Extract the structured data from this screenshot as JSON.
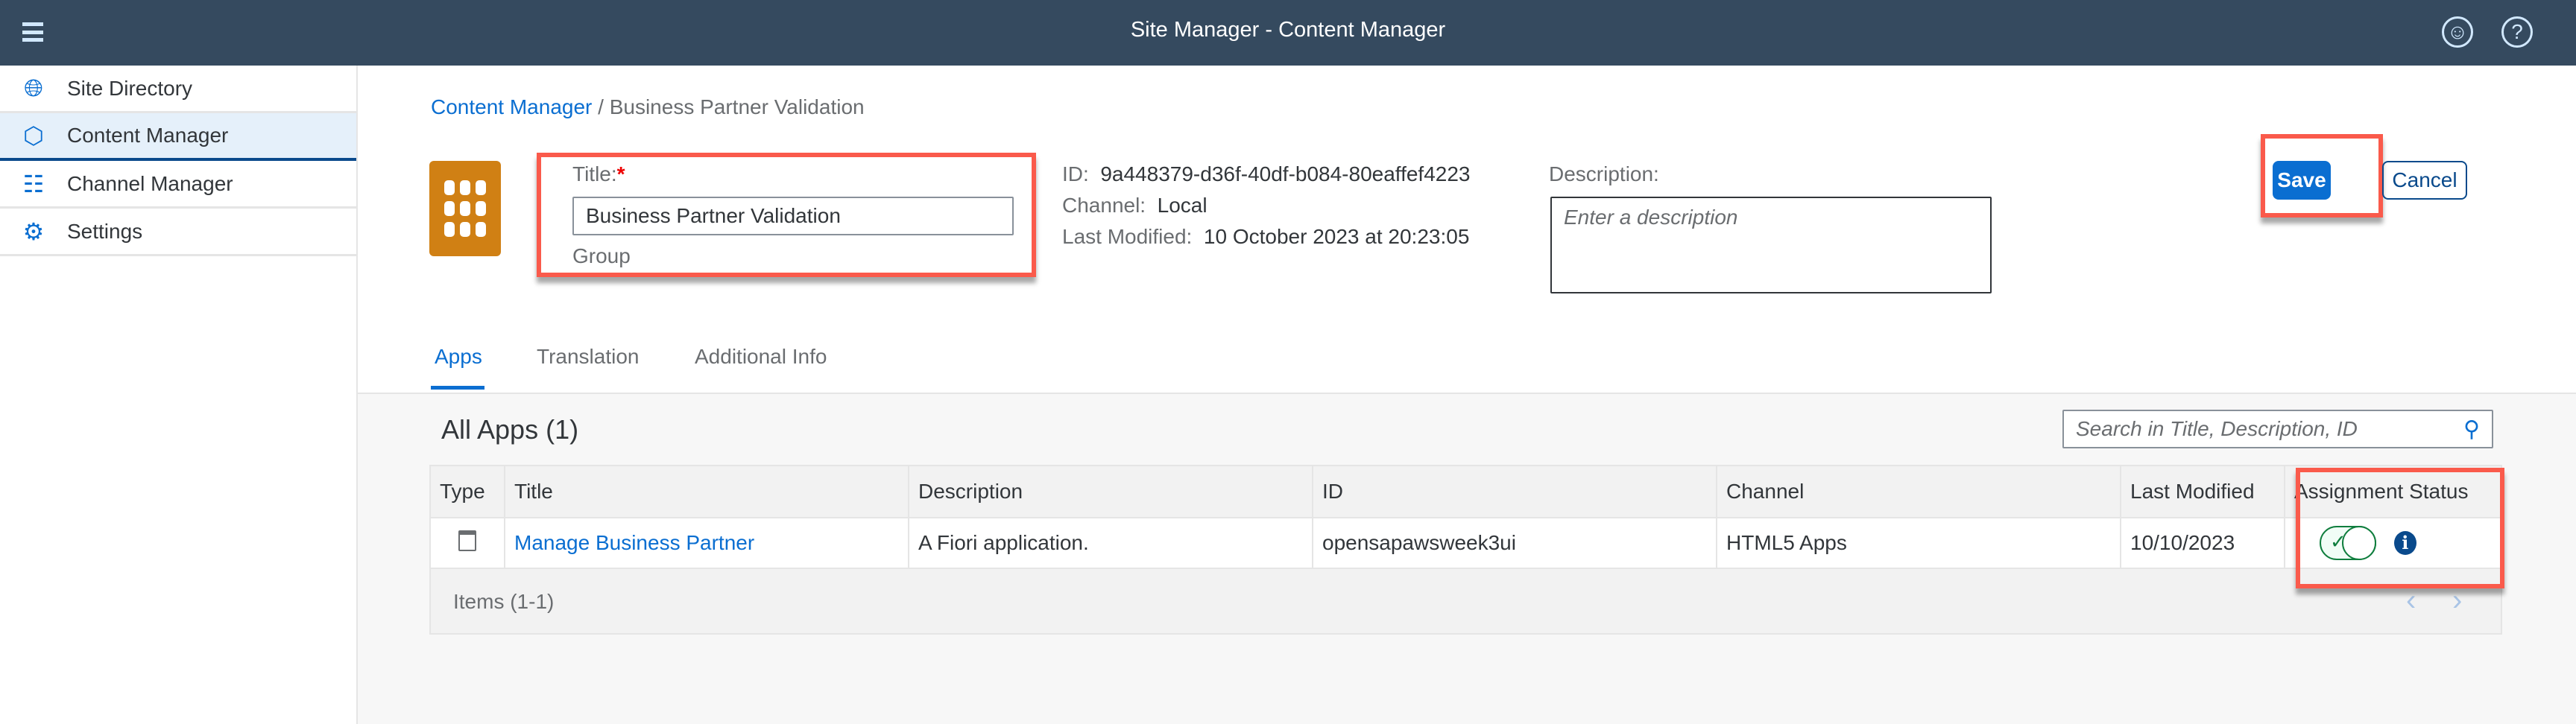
{
  "header": {
    "title": "Site Manager - Content Manager",
    "menu_icon": "hamburger-icon",
    "user_icon": "user-icon",
    "help_icon": "help-icon"
  },
  "sidebar": {
    "items": [
      {
        "label": "Site Directory",
        "icon": "globe-icon"
      },
      {
        "label": "Content Manager",
        "icon": "cube-icon",
        "selected": true
      },
      {
        "label": "Channel Manager",
        "icon": "hierarchy-icon"
      },
      {
        "label": "Settings",
        "icon": "gears-icon"
      }
    ]
  },
  "breadcrumb": {
    "link": "Content Manager",
    "separator": "/",
    "current": "Business Partner Validation"
  },
  "form": {
    "title_label": "Title:",
    "required_mark": "*",
    "title_value": "Business Partner Validation",
    "type_label": "Group",
    "id_label": "ID:",
    "id_value": "9a448379-d36f-40df-b084-80eaffef4223",
    "channel_label": "Channel:",
    "channel_value": "Local",
    "modified_label": "Last Modified:",
    "modified_value": "10 October 2023 at 20:23:05",
    "description_label": "Description:",
    "description_placeholder": "Enter a description"
  },
  "actions": {
    "save": "Save",
    "cancel": "Cancel"
  },
  "tabs": [
    {
      "label": "Apps",
      "selected": true
    },
    {
      "label": "Translation"
    },
    {
      "label": "Additional Info"
    }
  ],
  "apps": {
    "heading": "All Apps (1)",
    "search_placeholder": "Search in Title, Description, ID",
    "columns": [
      "Type",
      "Title",
      "Description",
      "ID",
      "Channel",
      "Last Modified",
      "Assignment Status"
    ],
    "rows": [
      {
        "type_icon": "app-window-icon",
        "title": "Manage Business Partner",
        "description": "A Fiori application.",
        "id": "opensapawsweek3ui",
        "channel": "HTML5 Apps",
        "last_modified": "10/10/2023",
        "assigned": true
      }
    ],
    "footer": "Items (1-1)"
  },
  "colors": {
    "shell": "#354a5f",
    "accent": "#0a6ed1",
    "tile": "#d08014",
    "highlight": "#fa5a4b",
    "toggle": "#107e3e"
  }
}
